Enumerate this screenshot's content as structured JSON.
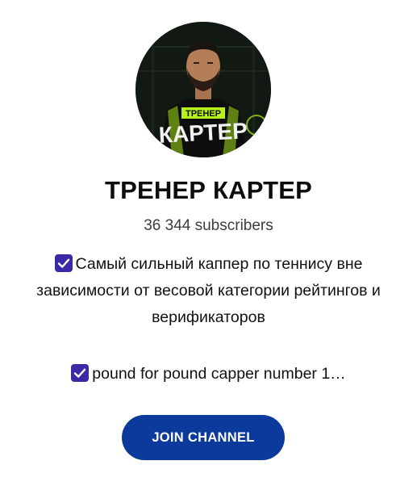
{
  "channel": {
    "name": "ТРЕНЕР КАРТЕР",
    "subscribers": "36 344 subscribers",
    "avatar": {
      "badge_top": "ТРЕНЕР",
      "badge_bottom": "КАРТЕР",
      "accent_color": "#b6f21c"
    }
  },
  "description": {
    "line1": "Самый сильный каппер по теннису вне",
    "line2": "зависимости от весовой категории рейтингов и",
    "line3": "верификаторов",
    "line4": "pound for pound capper number 1…",
    "check_icon_color": "#3b2aa8"
  },
  "actions": {
    "join_label": "JOIN CHANNEL",
    "join_color": "#0c3a9c"
  }
}
